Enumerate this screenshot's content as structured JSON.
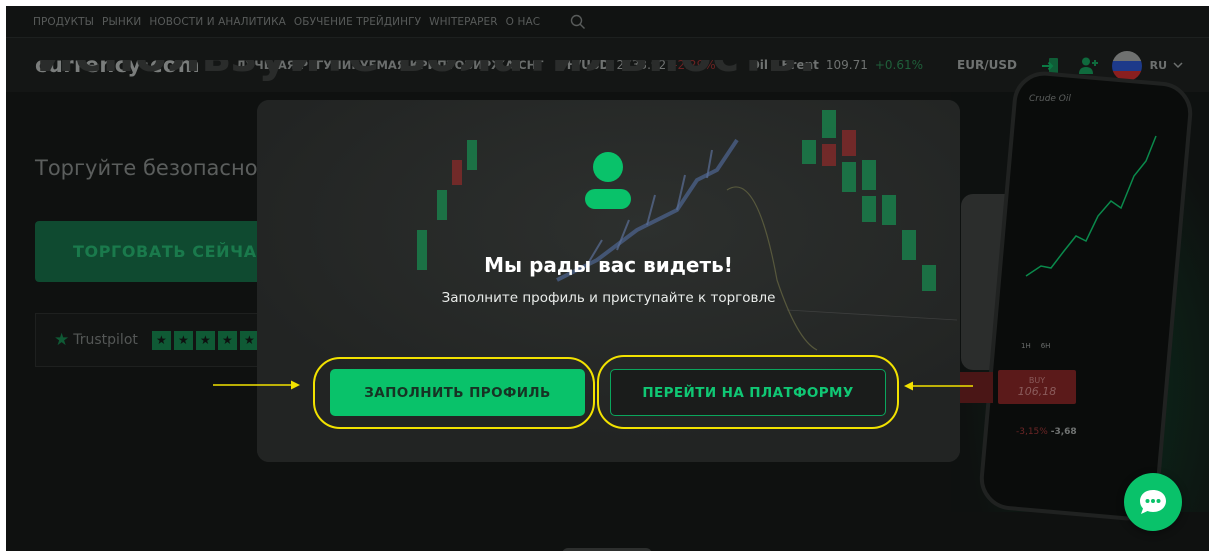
{
  "topnav": {
    "items": [
      "ПРОДУКТЫ",
      "РЫНКИ",
      "НОВОСТИ И АНАЛИТИКА",
      "ОБУЧЕНИЕ ТРЕЙДИНГУ",
      "WHITEPAPER",
      "О НАС"
    ]
  },
  "header": {
    "logo": "currency·com",
    "tagline": "ЛУЧШАЯ РЕГУЛИРУЕМАЯ КРИПТОБИРЖА СНГ",
    "tickers": [
      {
        "name": "TH/USD",
        "price": "2733.92",
        "change": "-2.29%",
        "direction": "down"
      },
      {
        "name": "Oil - Brent",
        "price": "109.71",
        "change": "+0.61%",
        "direction": "up"
      },
      {
        "name": "EUR/USD",
        "price": "",
        "change": "",
        "direction": ""
      }
    ],
    "language": "RU"
  },
  "hero": {
    "heading": "Используйте волатильность!",
    "subheading": "Торгуйте безопасно",
    "cta": "ТОРГОВАТЬ СЕЙЧАС",
    "trustpilot": "Trustpilot"
  },
  "phone": {
    "instrument": "Crude Oil",
    "buy_label": "BUY",
    "buy_price": "106,18",
    "change_pct": "-3,15%",
    "change_abs": "-3,68",
    "periods": [
      "1H",
      "6H"
    ]
  },
  "modal": {
    "title": "Мы рады вас видеть!",
    "subtitle": "Заполните профиль и приступайте к торговле",
    "fill_button": "ЗАПОЛНИТЬ ПРОФИЛЬ",
    "platform_button": "ПЕРЕЙТИ НА ПЛАТФОРМУ"
  },
  "colors": {
    "accent": "#09c26a",
    "annotation": "#f2e200",
    "negative": "#c0392b"
  }
}
